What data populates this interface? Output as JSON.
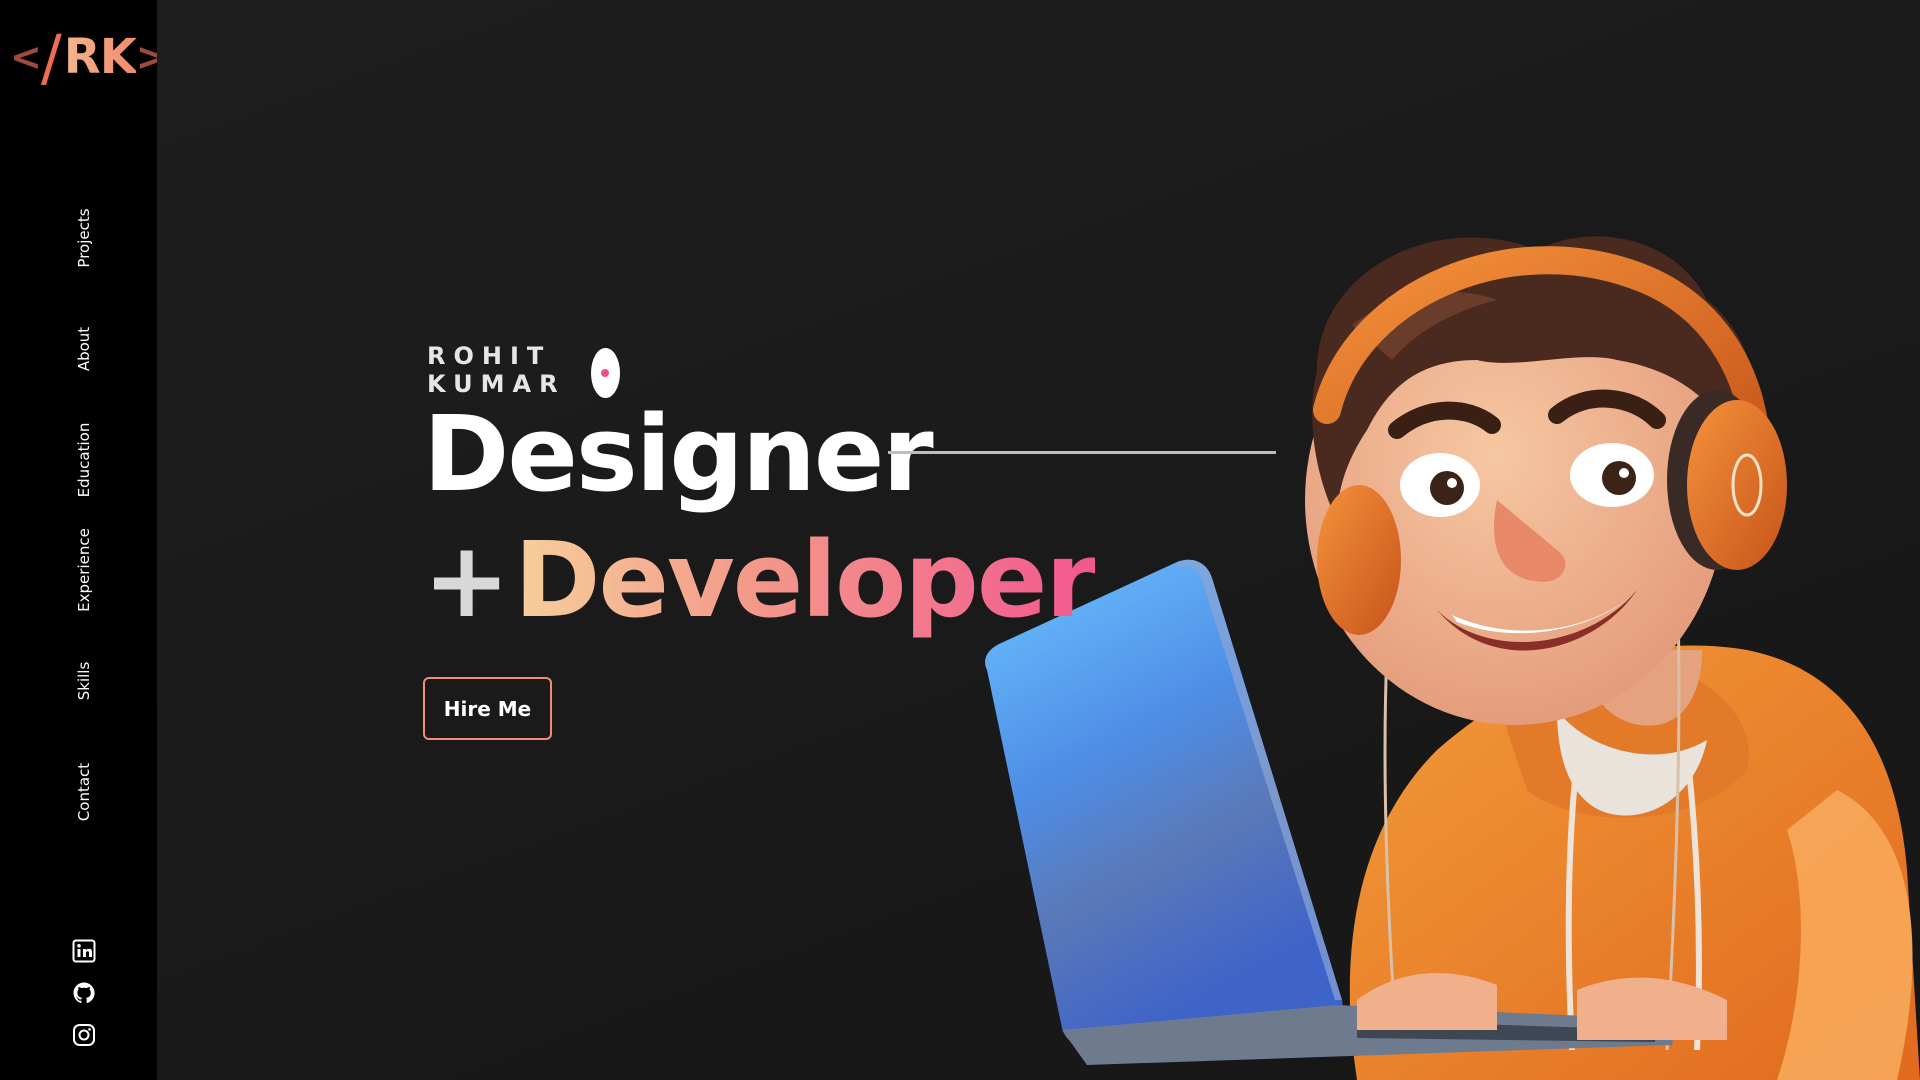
{
  "logo": {
    "open": "<",
    "slash": "/",
    "letters": "RK",
    "close": ">"
  },
  "nav": {
    "items": [
      {
        "label": "Projects"
      },
      {
        "label": "About"
      },
      {
        "label": "Education"
      },
      {
        "label": "Experience"
      },
      {
        "label": "Skills"
      },
      {
        "label": "Contact"
      }
    ]
  },
  "social": [
    "linkedin-icon",
    "github-icon",
    "instagram-icon"
  ],
  "hero": {
    "name": "ROHIT KUMAR",
    "line1": "Designer",
    "plus": "+",
    "line2": "Developer",
    "cta": "Hire Me"
  },
  "colors": {
    "sidebar": "#000000",
    "background": "#181818",
    "accent_pink": "#f2588f",
    "accent_peach": "#f7cf9b",
    "button_border": "#f28b7c"
  }
}
